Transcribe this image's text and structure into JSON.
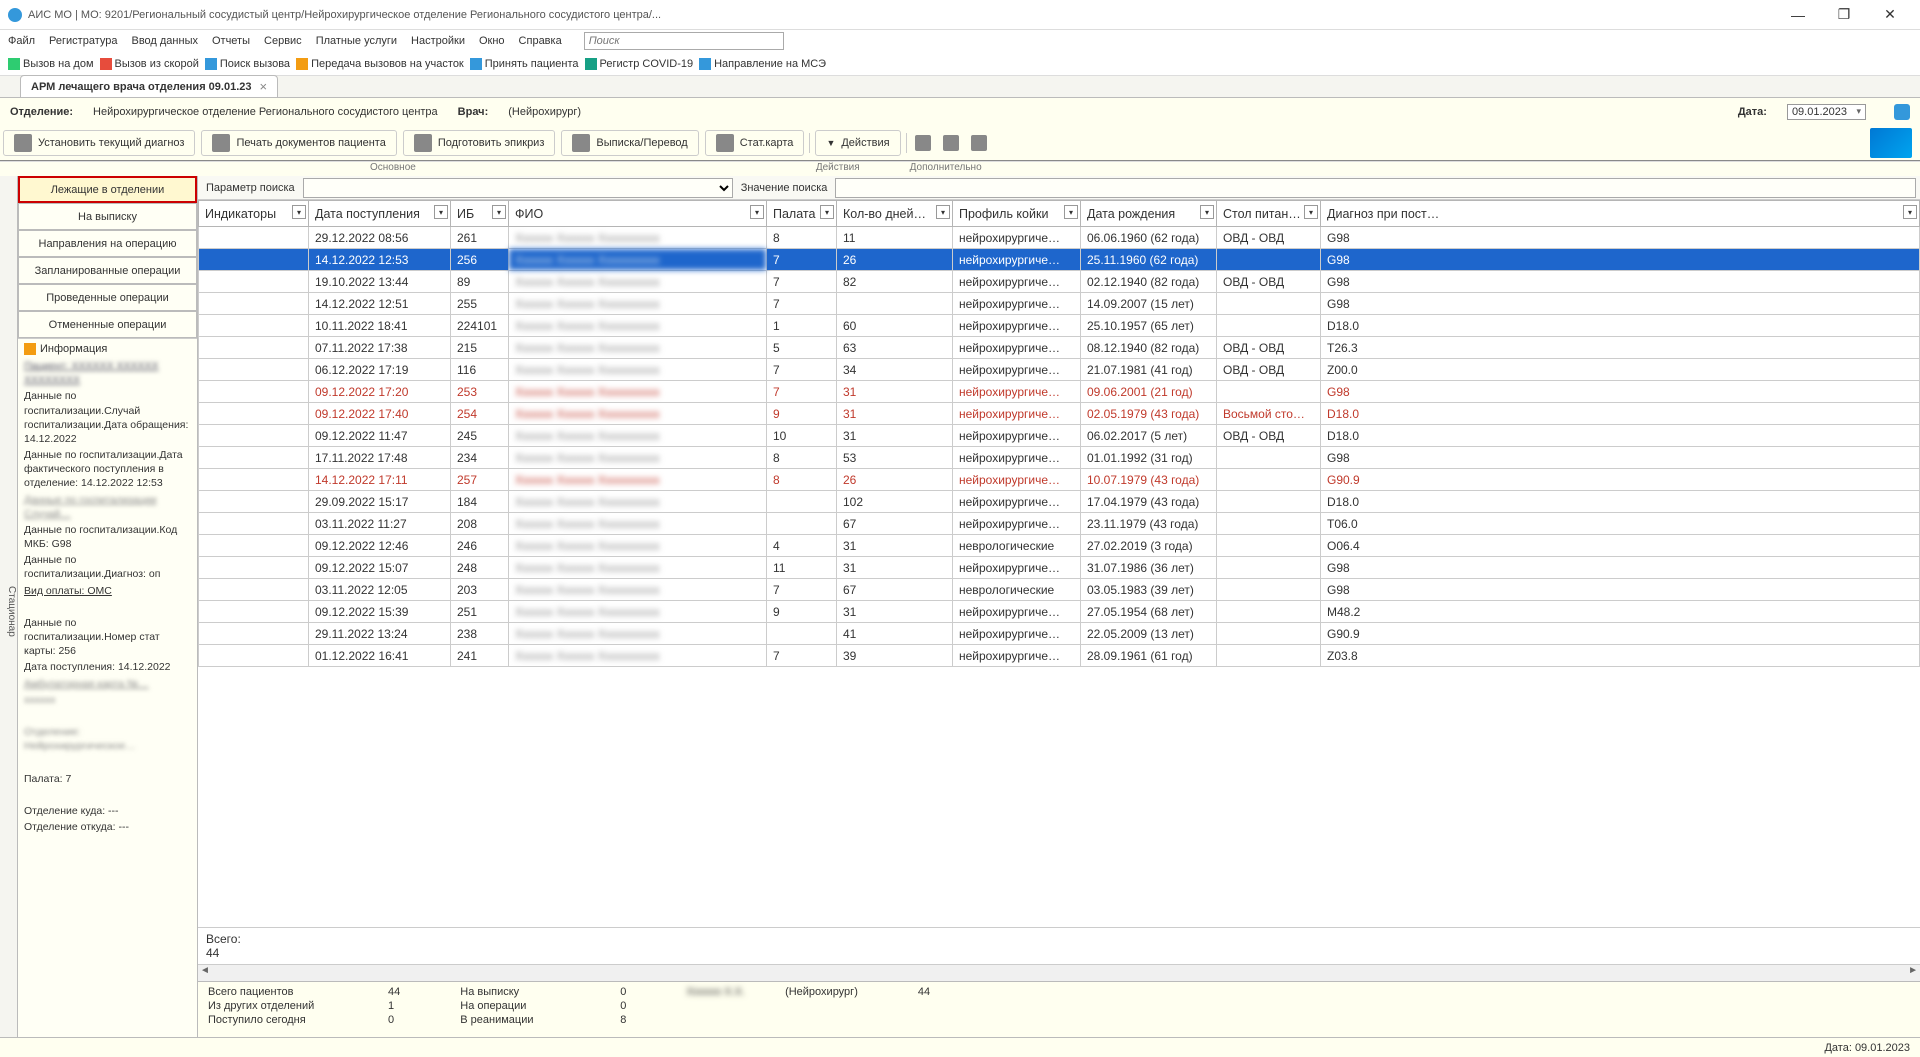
{
  "window": {
    "title": "АИС МО | МО: 9201/Региональный сосудистый центр/Нейрохирургическое отделение Регионального сосудистого центра/..."
  },
  "menu": [
    "Файл",
    "Регистратура",
    "Ввод данных",
    "Отчеты",
    "Сервис",
    "Платные услуги",
    "Настройки",
    "Окно",
    "Справка"
  ],
  "menu_search_ph": "Поиск",
  "toolbar1": [
    {
      "t": "Вызов на дом",
      "c": "ic-green"
    },
    {
      "t": "Вызов из скорой",
      "c": "ic-red"
    },
    {
      "t": "Поиск вызова",
      "c": "ic-blue"
    },
    {
      "t": "Передача вызовов на участок",
      "c": "ic-orange"
    },
    {
      "t": "Принять пациента",
      "c": "ic-blue"
    },
    {
      "t": "Регистр COVID-19",
      "c": "ic-teal"
    },
    {
      "t": "Направление на МСЭ",
      "c": "ic-blue"
    }
  ],
  "tab": {
    "label": "АРМ лечащего врача отделения 09.01.23"
  },
  "context": {
    "dept_lbl": "Отделение:",
    "dept": "Нейрохирургическое отделение Регионального сосудистого центра",
    "doc_lbl": "Врач:",
    "doc_spec": "(Нейрохирург)",
    "date_lbl": "Дата:",
    "date": "09.01.2023"
  },
  "toolbar2": {
    "main": [
      "Установить текущий диагноз",
      "Печать документов пациента",
      "Подготовить эпикриз",
      "Выписка/Перевод",
      "Стат.карта",
      "Действия"
    ],
    "grp1": "Основное",
    "grp2": "Действия",
    "grp3": "Дополнительно"
  },
  "nav": [
    "Лежащие в отделении",
    "На выписку",
    "Направления на операцию",
    "Запланированные операции",
    "Проведенные операции",
    "Отмененные операции"
  ],
  "info": {
    "title": "Информация",
    "lines": [
      "Данные по госпитализации.Случай госпитализации.Дата обращения: 14.12.2022",
      "Данные по госпитализации.Дата фактического поступления в отделение: 14.12.2022 12:53",
      "Данные по госпитализации.Код МКБ: G98",
      "Данные по госпитализации.Диагноз: оп",
      "Вид оплаты: ОМС",
      "Данные по госпитализации.Номер стат карты: 256",
      "Дата поступления: 14.12.2022",
      "Палата: 7",
      "Отделение куда: ---",
      "Отделение откуда: ---"
    ]
  },
  "search": {
    "param_lbl": "Параметр поиска",
    "val_lbl": "Значение поиска"
  },
  "cols": [
    "Индикаторы",
    "Дата поступления",
    "ИБ",
    "ФИО",
    "Палата",
    "Кол-во дней…",
    "Профиль койки",
    "Дата рождения",
    "Стол питан…",
    "Диагноз при пост…"
  ],
  "rows": [
    {
      "d": "29.12.2022 08:56",
      "ib": "261",
      "w": "8",
      "n": "11",
      "p": "нейрохирургиче…",
      "b": "06.06.1960 (62 года)",
      "f": "ОВД - ОВД",
      "dg": "G98"
    },
    {
      "d": "14.12.2022 12:53",
      "ib": "256",
      "w": "7",
      "n": "26",
      "p": "нейрохирургиче…",
      "b": "25.11.1960 (62 года)",
      "f": "",
      "dg": "G98",
      "sel": true
    },
    {
      "d": "19.10.2022 13:44",
      "ib": "89",
      "w": "7",
      "n": "82",
      "p": "нейрохирургиче…",
      "b": "02.12.1940 (82 года)",
      "f": "ОВД - ОВД",
      "dg": "G98"
    },
    {
      "d": "14.12.2022 12:51",
      "ib": "255",
      "w": "7",
      "n": "",
      "p": "нейрохирургиче…",
      "b": "14.09.2007 (15 лет)",
      "f": "",
      "dg": "G98"
    },
    {
      "d": "10.11.2022 18:41",
      "ib": "224101",
      "w": "1",
      "n": "60",
      "p": "нейрохирургиче…",
      "b": "25.10.1957 (65 лет)",
      "f": "",
      "dg": "D18.0"
    },
    {
      "d": "07.11.2022 17:38",
      "ib": "215",
      "w": "5",
      "n": "63",
      "p": "нейрохирургиче…",
      "b": "08.12.1940 (82 года)",
      "f": "ОВД - ОВД",
      "dg": "T26.3"
    },
    {
      "d": "06.12.2022 17:19",
      "ib": "116",
      "w": "7",
      "n": "34",
      "p": "нейрохирургиче…",
      "b": "21.07.1981 (41 год)",
      "f": "ОВД - ОВД",
      "dg": "Z00.0"
    },
    {
      "d": "09.12.2022 17:20",
      "ib": "253",
      "w": "7",
      "n": "31",
      "p": "нейрохирургиче…",
      "b": "09.06.2001 (21 год)",
      "f": "",
      "dg": "G98",
      "red": true
    },
    {
      "d": "09.12.2022 17:40",
      "ib": "254",
      "w": "9",
      "n": "31",
      "p": "нейрохирургиче…",
      "b": "02.05.1979 (43 года)",
      "f": "Восьмой сто…",
      "dg": "D18.0",
      "red": true
    },
    {
      "d": "09.12.2022 11:47",
      "ib": "245",
      "w": "10",
      "n": "31",
      "p": "нейрохирургиче…",
      "b": "06.02.2017 (5 лет)",
      "f": "ОВД - ОВД",
      "dg": "D18.0"
    },
    {
      "d": "17.11.2022 17:48",
      "ib": "234",
      "w": "8",
      "n": "53",
      "p": "нейрохирургиче…",
      "b": "01.01.1992 (31 год)",
      "f": "",
      "dg": "G98"
    },
    {
      "d": "14.12.2022 17:11",
      "ib": "257",
      "w": "8",
      "n": "26",
      "p": "нейрохирургиче…",
      "b": "10.07.1979 (43 года)",
      "f": "",
      "dg": "G90.9",
      "red": true
    },
    {
      "d": "29.09.2022 15:17",
      "ib": "184",
      "w": "",
      "n": "102",
      "p": "нейрохирургиче…",
      "b": "17.04.1979 (43 года)",
      "f": "",
      "dg": "D18.0"
    },
    {
      "d": "03.11.2022 11:27",
      "ib": "208",
      "w": "",
      "n": "67",
      "p": "нейрохирургиче…",
      "b": "23.11.1979 (43 года)",
      "f": "",
      "dg": "T06.0"
    },
    {
      "d": "09.12.2022 12:46",
      "ib": "246",
      "w": "4",
      "n": "31",
      "p": "неврологические",
      "b": "27.02.2019 (3 года)",
      "f": "",
      "dg": "O06.4"
    },
    {
      "d": "09.12.2022 15:07",
      "ib": "248",
      "w": "11",
      "n": "31",
      "p": "нейрохирургиче…",
      "b": "31.07.1986 (36 лет)",
      "f": "",
      "dg": "G98"
    },
    {
      "d": "03.11.2022 12:05",
      "ib": "203",
      "w": "7",
      "n": "67",
      "p": "неврологические",
      "b": "03.05.1983 (39 лет)",
      "f": "",
      "dg": "G98"
    },
    {
      "d": "09.12.2022 15:39",
      "ib": "251",
      "w": "9",
      "n": "31",
      "p": "нейрохирургиче…",
      "b": "27.05.1954 (68 лет)",
      "f": "",
      "dg": "M48.2"
    },
    {
      "d": "29.11.2022 13:24",
      "ib": "238",
      "w": "",
      "n": "41",
      "p": "нейрохирургиче…",
      "b": "22.05.2009 (13 лет)",
      "f": "",
      "dg": "G90.9"
    },
    {
      "d": "01.12.2022 16:41",
      "ib": "241",
      "w": "7",
      "n": "39",
      "p": "нейрохирургиче…",
      "b": "28.09.1961 (61 год)",
      "f": "",
      "dg": "Z03.8"
    }
  ],
  "totals": {
    "lbl": "Всего:",
    "val": "44"
  },
  "stats": {
    "a": [
      [
        "Всего пациентов",
        "44"
      ],
      [
        "Из других отделений",
        "1"
      ],
      [
        "Поступило сегодня",
        "0"
      ]
    ],
    "b": [
      [
        "На выписку",
        "0"
      ],
      [
        "На операции",
        "0"
      ],
      [
        "В реанимации",
        "8"
      ]
    ],
    "c_spec": "(Нейрохирург)",
    "c_num": "44"
  },
  "status": {
    "date": "Дата: 09.01.2023"
  }
}
